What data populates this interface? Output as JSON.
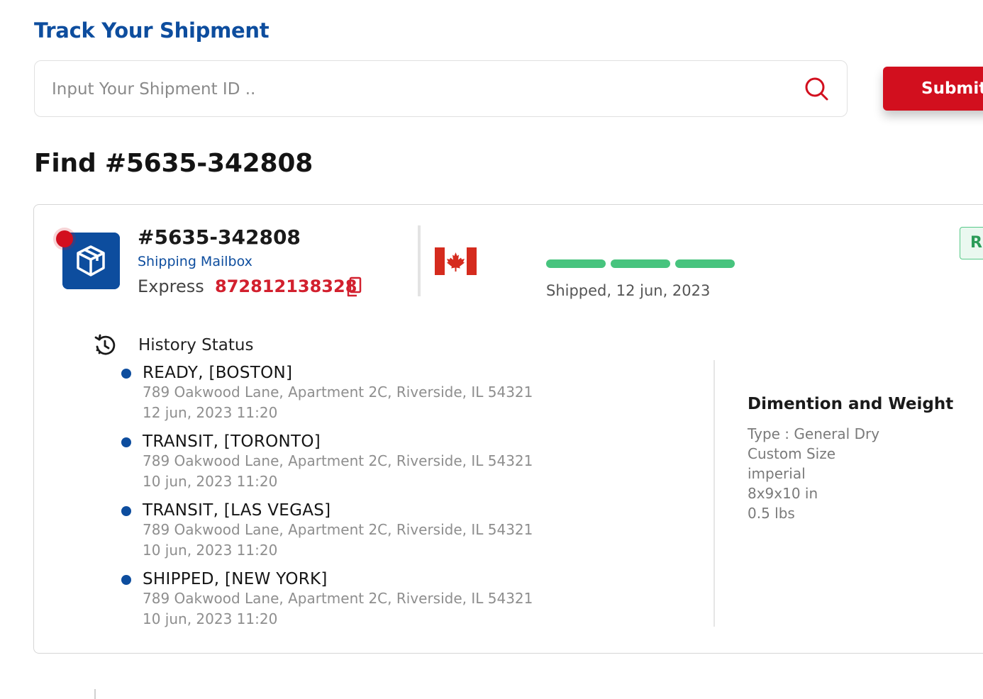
{
  "header": {
    "title": "Track Your Shipment",
    "search_placeholder": "Input Your Shipment ID ..",
    "submit_label": "Submit"
  },
  "find": {
    "title": "Find #5635-342808"
  },
  "shipment": {
    "id": "#5635-342808",
    "type": "Shipping Mailbox",
    "service_label": "Express",
    "tracking_number": "872812138328",
    "progress_segments_complete": 3,
    "progress_segments_total": 3,
    "shipped_date": "Shipped, 12 jun, 2023",
    "status_badge": "R",
    "colors": {
      "brand_blue": "#0d4d9e",
      "accent_red": "#d20f1e",
      "progress_green": "#47c47e"
    }
  },
  "history": {
    "title": "History Status",
    "events": [
      {
        "title": "READY, [BOSTON]",
        "address": "789 Oakwood Lane, Apartment 2C, Riverside, IL 54321",
        "time": "12 jun, 2023 11:20"
      },
      {
        "title": "TRANSIT, [TORONTO]",
        "address": "789 Oakwood Lane, Apartment 2C, Riverside, IL 54321",
        "time": "10 jun, 2023 11:20"
      },
      {
        "title": "TRANSIT, [LAS VEGAS]",
        "address": "789 Oakwood Lane, Apartment 2C, Riverside, IL 54321",
        "time": "10 jun, 2023 11:20"
      },
      {
        "title": "SHIPPED, [NEW YORK]",
        "address": "789 Oakwood Lane, Apartment 2C, Riverside, IL 54321",
        "time": "10 jun, 2023 11:20"
      }
    ]
  },
  "dimensions": {
    "title": "Dimention and Weight",
    "lines": [
      "Type : General Dry",
      "Custom Size",
      "imperial",
      "8x9x10 in",
      "0.5 lbs"
    ]
  }
}
